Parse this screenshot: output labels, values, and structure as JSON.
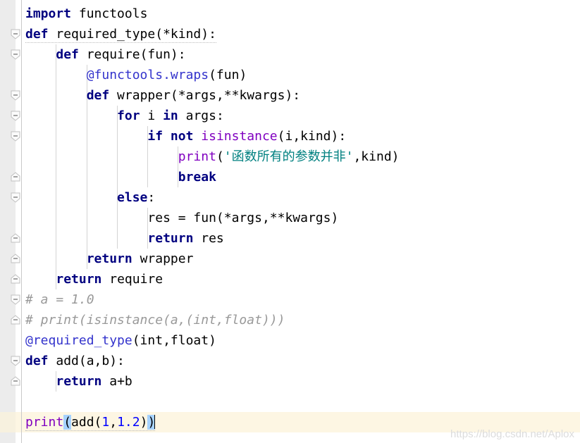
{
  "editor": {
    "app": "python-code-editor",
    "language": "Python",
    "watermark": "https://blog.csdn.net/Aplox",
    "colors": {
      "background": "#ffffff",
      "gutter": "#ececec",
      "current_line": "#fdf6e3",
      "keyword": "#000080",
      "builtin": "#8000c0",
      "decorator": "#3333cc",
      "string": "#008080",
      "number": "#0000ff",
      "comment": "#999999",
      "bracket_match": "#a6d2ff",
      "indent_guide": "#d4d4d4",
      "text": "#000000"
    },
    "cursor": {
      "line": 19,
      "column": 16,
      "visible": true
    },
    "bracket_match": {
      "open": "(",
      "close": ")"
    }
  },
  "lines": [
    {
      "n": 1,
      "indent": 0,
      "fold": null,
      "squiggle": false,
      "tokens": [
        {
          "t": "import",
          "c": "kw"
        },
        {
          "t": " functools",
          "c": "plain"
        }
      ]
    },
    {
      "n": 2,
      "indent": 0,
      "fold": "start",
      "squiggle": true,
      "tokens": [
        {
          "t": "def",
          "c": "kw"
        },
        {
          "t": " required_type(*kind):",
          "c": "plain"
        }
      ]
    },
    {
      "n": 3,
      "indent": 1,
      "fold": "start",
      "squiggle": false,
      "tokens": [
        {
          "t": "    ",
          "c": "plain"
        },
        {
          "t": "def",
          "c": "kw"
        },
        {
          "t": " require(fun):",
          "c": "plain"
        }
      ]
    },
    {
      "n": 4,
      "indent": 2,
      "fold": null,
      "squiggle": false,
      "tokens": [
        {
          "t": "        ",
          "c": "plain"
        },
        {
          "t": "@functools.wraps",
          "c": "deco"
        },
        {
          "t": "(fun)",
          "c": "plain"
        }
      ]
    },
    {
      "n": 5,
      "indent": 2,
      "fold": "start",
      "squiggle": false,
      "tokens": [
        {
          "t": "        ",
          "c": "plain"
        },
        {
          "t": "def",
          "c": "kw"
        },
        {
          "t": " wrapper(*args,**kwargs):",
          "c": "plain"
        }
      ]
    },
    {
      "n": 6,
      "indent": 3,
      "fold": "start",
      "squiggle": false,
      "tokens": [
        {
          "t": "            ",
          "c": "plain"
        },
        {
          "t": "for",
          "c": "kw"
        },
        {
          "t": " i ",
          "c": "plain"
        },
        {
          "t": "in",
          "c": "kw"
        },
        {
          "t": " args:",
          "c": "plain"
        }
      ]
    },
    {
      "n": 7,
      "indent": 4,
      "fold": "start",
      "squiggle": false,
      "tokens": [
        {
          "t": "                ",
          "c": "plain"
        },
        {
          "t": "if not",
          "c": "kw"
        },
        {
          "t": " ",
          "c": "plain"
        },
        {
          "t": "isinstance",
          "c": "bif"
        },
        {
          "t": "(i,kind):",
          "c": "plain"
        }
      ]
    },
    {
      "n": 8,
      "indent": 5,
      "fold": null,
      "squiggle": false,
      "tokens": [
        {
          "t": "                    ",
          "c": "plain"
        },
        {
          "t": "print",
          "c": "bif"
        },
        {
          "t": "(",
          "c": "plain"
        },
        {
          "t": "'函数所有的参数并非'",
          "c": "str"
        },
        {
          "t": ",kind)",
          "c": "plain"
        }
      ]
    },
    {
      "n": 9,
      "indent": 5,
      "fold": "end",
      "squiggle": false,
      "tokens": [
        {
          "t": "                    ",
          "c": "plain"
        },
        {
          "t": "break",
          "c": "kw"
        }
      ]
    },
    {
      "n": 10,
      "indent": 3,
      "fold": "start",
      "squiggle": false,
      "tokens": [
        {
          "t": "            ",
          "c": "plain"
        },
        {
          "t": "else",
          "c": "kw"
        },
        {
          "t": ":",
          "c": "plain"
        }
      ]
    },
    {
      "n": 11,
      "indent": 4,
      "fold": null,
      "squiggle": false,
      "tokens": [
        {
          "t": "                res = fun(*args,**kwargs)",
          "c": "plain"
        }
      ]
    },
    {
      "n": 12,
      "indent": 4,
      "fold": "end",
      "squiggle": false,
      "tokens": [
        {
          "t": "                ",
          "c": "plain"
        },
        {
          "t": "return",
          "c": "kw"
        },
        {
          "t": " res",
          "c": "plain"
        }
      ]
    },
    {
      "n": 13,
      "indent": 2,
      "fold": "end",
      "squiggle": false,
      "tokens": [
        {
          "t": "        ",
          "c": "plain"
        },
        {
          "t": "return",
          "c": "kw"
        },
        {
          "t": " wrapper",
          "c": "plain"
        }
      ]
    },
    {
      "n": 14,
      "indent": 1,
      "fold": "end",
      "squiggle": false,
      "tokens": [
        {
          "t": "    ",
          "c": "plain"
        },
        {
          "t": "return",
          "c": "kw"
        },
        {
          "t": " require",
          "c": "plain"
        }
      ]
    },
    {
      "n": 15,
      "indent": 0,
      "fold": "start",
      "squiggle": false,
      "tokens": [
        {
          "t": "# a = 1.0",
          "c": "cmt"
        }
      ]
    },
    {
      "n": 16,
      "indent": 0,
      "fold": "end",
      "squiggle": false,
      "tokens": [
        {
          "t": "# print(isinstance(a,(int,float)))",
          "c": "cmt"
        }
      ]
    },
    {
      "n": 17,
      "indent": 0,
      "fold": null,
      "squiggle": false,
      "tokens": [
        {
          "t": "@required_type",
          "c": "deco"
        },
        {
          "t": "(int,float)",
          "c": "plain"
        }
      ]
    },
    {
      "n": 18,
      "indent": 0,
      "fold": "start",
      "squiggle": false,
      "tokens": [
        {
          "t": "def",
          "c": "kw"
        },
        {
          "t": " add(a,b):",
          "c": "plain"
        }
      ]
    },
    {
      "n": 19,
      "indent": 1,
      "fold": "end",
      "squiggle": false,
      "tokens": [
        {
          "t": "    ",
          "c": "plain"
        },
        {
          "t": "return",
          "c": "kw"
        },
        {
          "t": " a+b",
          "c": "plain"
        }
      ]
    },
    {
      "n": 20,
      "indent": 0,
      "fold": null,
      "squiggle": false,
      "tokens": []
    },
    {
      "n": 21,
      "indent": 0,
      "fold": null,
      "squiggle": true,
      "current": true,
      "tokens": [
        {
          "t": "print",
          "c": "bif"
        },
        {
          "t": "(",
          "c": "plain brk"
        },
        {
          "t": "add(",
          "c": "plain"
        },
        {
          "t": "1",
          "c": "num"
        },
        {
          "t": ",",
          "c": "plain"
        },
        {
          "t": "1.2",
          "c": "num"
        },
        {
          "t": ")",
          "c": "plain"
        },
        {
          "t": ")",
          "c": "plain brk"
        },
        {
          "t": "",
          "c": "caret"
        }
      ]
    }
  ],
  "indent_guides": [
    {
      "indent": 1,
      "from_line": 3,
      "to_line": 14
    },
    {
      "indent": 2,
      "from_line": 4,
      "to_line": 13
    },
    {
      "indent": 3,
      "from_line": 6,
      "to_line": 12
    },
    {
      "indent": 4,
      "from_line": 7,
      "to_line": 9
    },
    {
      "indent": 4,
      "from_line": 11,
      "to_line": 12
    },
    {
      "indent": 5,
      "from_line": 8,
      "to_line": 9
    },
    {
      "indent": 1,
      "from_line": 19,
      "to_line": 19
    }
  ]
}
